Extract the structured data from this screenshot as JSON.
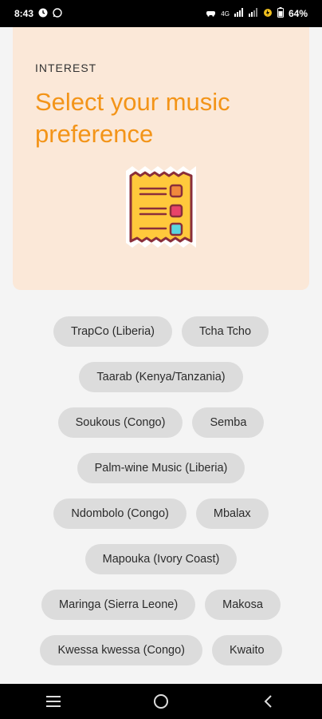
{
  "status_bar": {
    "time": "8:43",
    "network": "4G",
    "battery": "64%"
  },
  "header": {
    "eyebrow": "INTEREST",
    "title": "Select your music preference",
    "background_color": "#fbe8d8",
    "title_color": "#f39418"
  },
  "genres": [
    [
      "TrapCo (Liberia)",
      "Tcha Tcho"
    ],
    [
      "Taarab (Kenya/Tanzania)"
    ],
    [
      "Soukous (Congo)",
      "Semba"
    ],
    [
      "Palm-wine Music (Liberia)"
    ],
    [
      "Ndombolo (Congo)",
      "Mbalax"
    ],
    [
      "Mapouka (Ivory Coast)"
    ],
    [
      "Maringa (Sierra Leone)",
      "Makosa"
    ],
    [
      "Kwessa kwessa (Congo)",
      "Kwaito"
    ]
  ],
  "nav": {
    "icons": [
      "menu-icon",
      "home-icon",
      "back-icon"
    ]
  }
}
